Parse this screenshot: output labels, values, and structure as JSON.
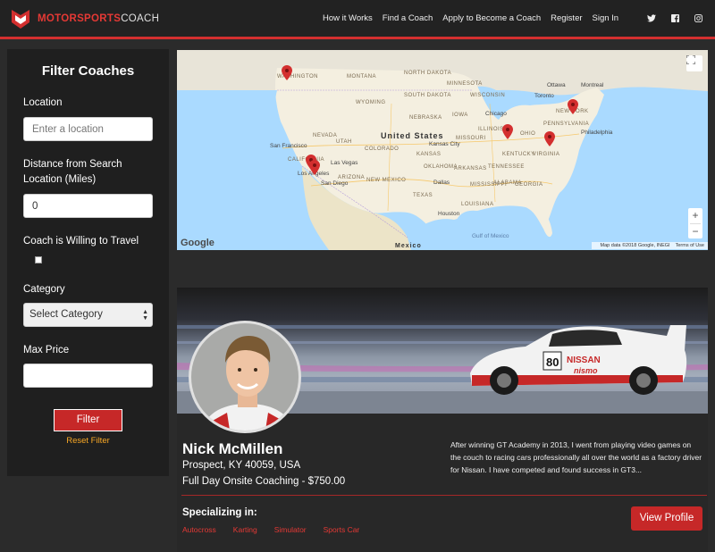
{
  "brand": {
    "name_bold": "MOTORSPORTS",
    "name_light": "COACH",
    "accent": "#d32f2f"
  },
  "nav": {
    "items": [
      {
        "label": "How it Works"
      },
      {
        "label": "Find a Coach"
      },
      {
        "label": "Apply to Become a Coach"
      },
      {
        "label": "Register"
      },
      {
        "label": "Sign In"
      }
    ],
    "social": [
      "twitter-icon",
      "facebook-icon",
      "instagram-icon"
    ]
  },
  "filter": {
    "title": "Filter Coaches",
    "location_label": "Location",
    "location_placeholder": "Enter a location",
    "distance_label": "Distance from Search Location (Miles)",
    "distance_value": "0",
    "travel_label": "Coach is Willing to Travel",
    "travel_checked": false,
    "category_label": "Category",
    "category_value": "Select Category",
    "price_label": "Max Price",
    "price_value": "",
    "filter_button": "Filter",
    "reset_link": "Reset Filter"
  },
  "map": {
    "country_labels": [
      "United States",
      "Mexico"
    ],
    "cities": [
      "San Francisco",
      "Las Vegas",
      "Los Angeles",
      "San Diego",
      "Dallas",
      "Houston",
      "Chicago",
      "Toronto",
      "Ottawa",
      "Montreal",
      "Philadelphia",
      "Kansas City"
    ],
    "states": [
      "WASHINGTON",
      "MONTANA",
      "NORTH DAKOTA",
      "SOUTH DAKOTA",
      "WYOMING",
      "NEBRASKA",
      "NEVADA",
      "UTAH",
      "COLORADO",
      "KANSAS",
      "CALIFORNIA",
      "ARIZONA",
      "NEW MEXICO",
      "OKLAHOMA",
      "TEXAS",
      "MINNESOTA",
      "WISCONSIN",
      "IOWA",
      "ILLINOIS",
      "MISSOURI",
      "KENTUCKY",
      "TENNESSEE",
      "VIRGINIA",
      "OHIO",
      "GEORGIA",
      "ALABAMA",
      "MISSISSIPPI",
      "LOUISIANA",
      "ARKANSAS",
      "NEW YORK",
      "PENNSYLVANIA"
    ],
    "water_label": "Gulf of Mexico",
    "google_logo": "Google",
    "attribution": "Map data ©2018 Google, INEGI",
    "terms": "Terms of Use",
    "zoom_in": "+",
    "zoom_out": "−"
  },
  "coach": {
    "name": "Nick McMillen",
    "location": "Prospect, KY 40059, USA",
    "price_line": "Full Day Onsite Coaching - $750.00",
    "bio": "After winning GT Academy in 2013, I went from playing video games on the couch to racing cars professionally all over the world as a factory driver for Nissan. I have competed and found success in GT3...",
    "specializing_label": "Specializing in:",
    "specialties": [
      "Autocross",
      "Karting",
      "Simulator",
      "Sports Car"
    ],
    "view_button": "View Profile",
    "car_number": "80",
    "car_brand": "NISSAN",
    "car_sub": "nismo"
  }
}
